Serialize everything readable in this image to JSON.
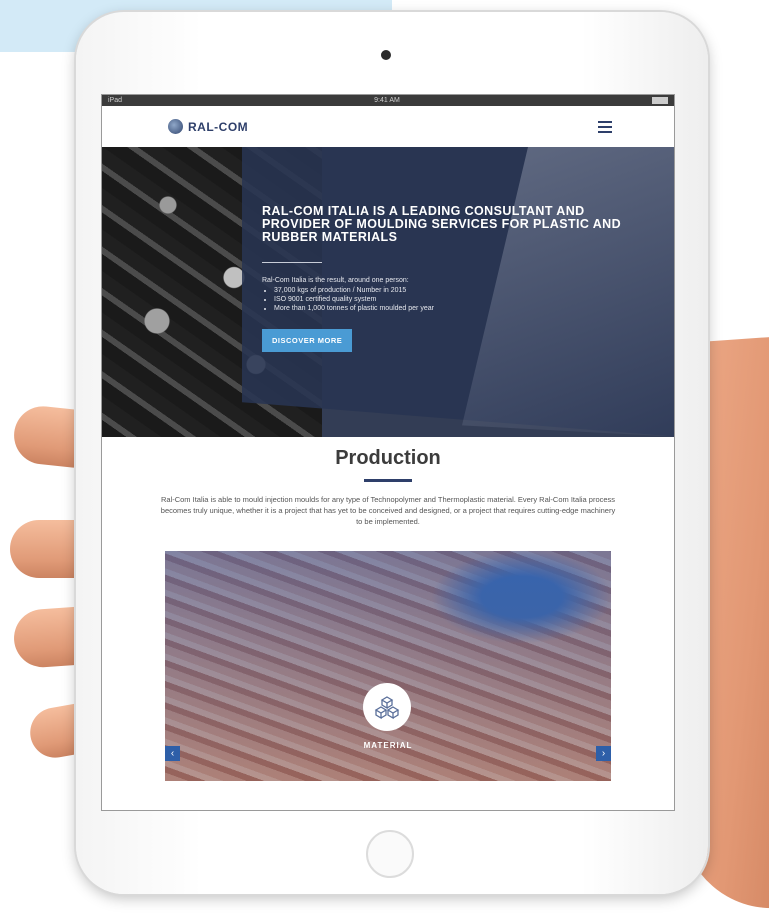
{
  "status": {
    "carrier": "iPad",
    "time": "9:41 AM"
  },
  "brand": {
    "logo_text": "RAL-COM"
  },
  "nav": {
    "menu_icon": "hamburger-icon"
  },
  "hero": {
    "title": "RAL-COM ITALIA IS A LEADING CONSULTANT AND PROVIDER OF MOULDING SERVICES FOR PLASTIC AND RUBBER MATERIALS",
    "lead": "Ral-Com Italia is the result, around one person:",
    "bullets": [
      "37,000 kgs of production / Number in 2015",
      "ISO 9001 certified quality system",
      "More than 1,000 tonnes of plastic moulded per year"
    ],
    "button_label": "DISCOVER MORE"
  },
  "production": {
    "title": "Production",
    "body": "Ral-Com Italia is able to mould injection moulds for any type of Technopolymer and Thermoplastic material. Every Ral-Com Italia process becomes truly unique, whether it is a project that has yet to be conceived and designed, or a project that requires cutting-edge machinery to be implemented."
  },
  "slider": {
    "label": "MATERIAL",
    "badge_icon": "cubes-icon",
    "prev_icon": "chevron-left-icon",
    "next_icon": "chevron-right-icon",
    "prev_symbol": "‹",
    "next_symbol": "›"
  },
  "colors": {
    "accent": "#4a9bd4",
    "brand": "#2e3f6a",
    "page_bg": "#d3eaf7"
  }
}
